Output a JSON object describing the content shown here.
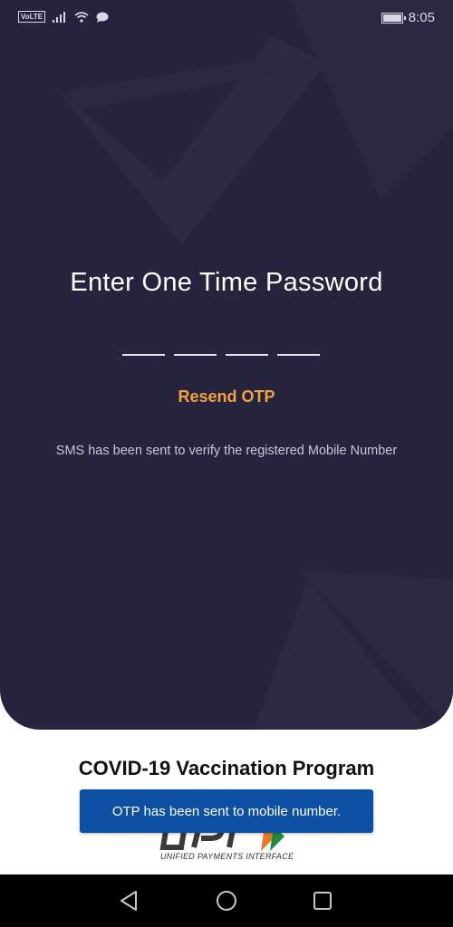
{
  "status_bar": {
    "volte": "VoLTE",
    "time": "8:05",
    "battery_level": 1.0,
    "icons": [
      "signal-icon",
      "wifi-icon",
      "chat-icon",
      "battery-icon"
    ]
  },
  "otp_screen": {
    "title": "Enter One Time Password",
    "otp_digits": [
      "",
      "",
      "",
      ""
    ],
    "resend_label": "Resend OTP",
    "sms_info": "SMS has been sent to verify the registered Mobile Number"
  },
  "footer": {
    "program_title": "COVID-19 Vaccination Program",
    "upi_tagline": "UNIFIED PAYMENTS INTERFACE"
  },
  "toast": {
    "message": "OTP has been sent to mobile number."
  },
  "nav": {
    "icons": [
      "back-icon",
      "home-icon",
      "recents-icon"
    ]
  },
  "colors": {
    "panel_bg": "#26233f",
    "accent": "#f2a33a",
    "toast_bg": "#0d4fa3"
  }
}
